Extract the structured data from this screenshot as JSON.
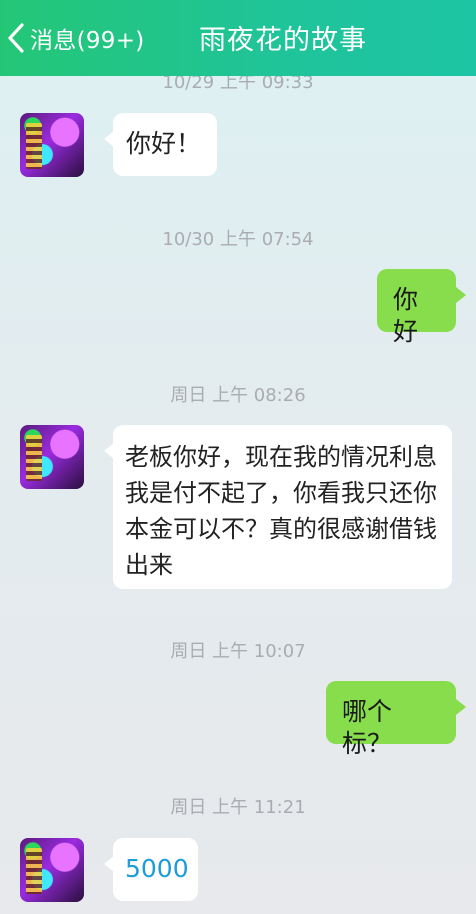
{
  "header": {
    "back_label": "消息(99+)",
    "title": "雨夜花的故事",
    "accent": "#24c676"
  },
  "messages": [
    {
      "timestamp": "10/29 上午 09:33",
      "side": "left",
      "text": "你好！"
    },
    {
      "timestamp": "10/30 上午 07:54",
      "side": "right",
      "text": "你好"
    },
    {
      "timestamp": "周日 上午 08:26",
      "side": "left",
      "text": "老板你好，现在我的情况利息我是付不起了，你看我只还你本金可以不？真的很感谢借钱出来"
    },
    {
      "timestamp": "周日 上午 10:07",
      "side": "right",
      "text": "哪个标？"
    },
    {
      "timestamp": "周日 上午 11:21",
      "side": "left",
      "text": "5000"
    }
  ],
  "colors": {
    "sent_bubble": "#88dd4c",
    "received_bubble": "#ffffff",
    "timestamp_text": "#a9adb2",
    "link_text": "#1e9cd8"
  }
}
